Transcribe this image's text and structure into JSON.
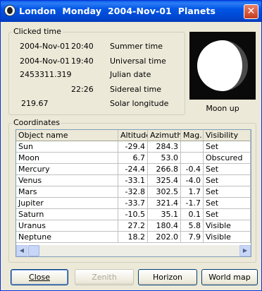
{
  "window": {
    "title": "London  Monday  2004-Nov-01  Planets",
    "close_glyph": "✕"
  },
  "clicked_time": {
    "label": "Clicked time",
    "rows": [
      {
        "values": [
          "2004-Nov-01",
          "20:40"
        ],
        "caption": "Summer time"
      },
      {
        "values": [
          "2004-Nov-01",
          "19:40"
        ],
        "caption": "Universal time"
      },
      {
        "values": [
          "2453311.319"
        ],
        "caption": "Julian date"
      },
      {
        "values": [
          "22:26"
        ],
        "caption": "Sidereal time"
      },
      {
        "values": [
          "219.67"
        ],
        "caption": "Solar longitude"
      }
    ]
  },
  "moon": {
    "caption": "Moon up"
  },
  "coordinates": {
    "label": "Coordinates",
    "columns": [
      "Object name",
      "Altitude",
      "Azimuth",
      "Mag.",
      "Visibility"
    ],
    "rows": [
      [
        "Sun",
        "-29.4",
        "284.3",
        "",
        "Set"
      ],
      [
        "Moon",
        "6.7",
        "53.0",
        "",
        "Obscured"
      ],
      [
        "Mercury",
        "-24.4",
        "266.8",
        "-0.4",
        "Set"
      ],
      [
        "Venus",
        "-33.1",
        "325.4",
        "-4.0",
        "Set"
      ],
      [
        "Mars",
        "-32.8",
        "302.5",
        "1.7",
        "Set"
      ],
      [
        "Jupiter",
        "-33.7",
        "321.4",
        "-1.7",
        "Set"
      ],
      [
        "Saturn",
        "-10.5",
        "35.1",
        "0.1",
        "Set"
      ],
      [
        "Uranus",
        "27.2",
        "180.4",
        "5.8",
        "Visible"
      ],
      [
        "Neptune",
        "18.2",
        "202.0",
        "7.9",
        "Visible"
      ]
    ]
  },
  "buttons": {
    "close": "Close",
    "zenith": "Zenith",
    "horizon": "Horizon",
    "world_map": "World map"
  },
  "colors": {
    "title_bar": "#0055e5",
    "moon_sky": "#0a0a0a",
    "dialog_bg": "#ece9d8"
  }
}
